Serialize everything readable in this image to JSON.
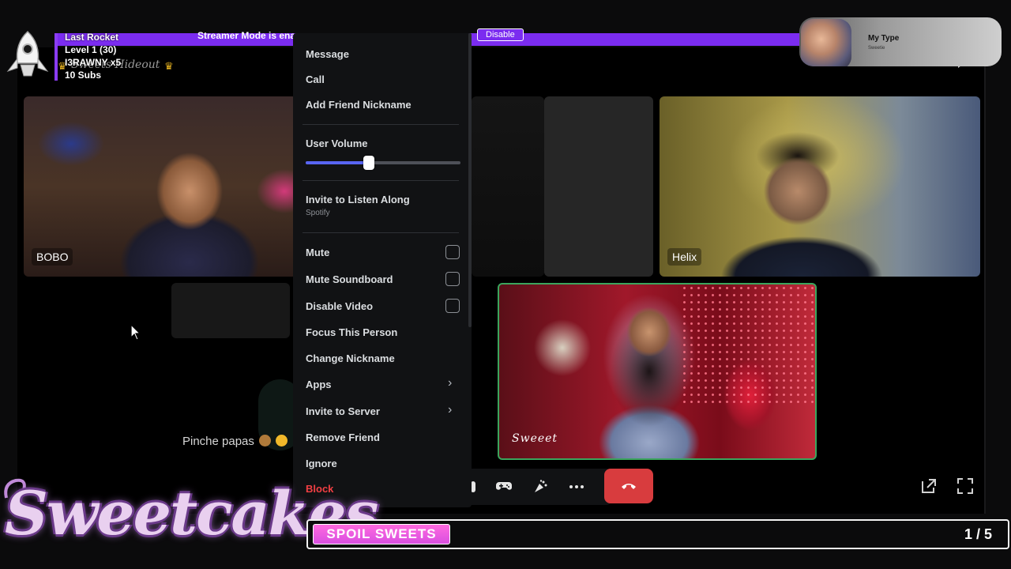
{
  "overlay": {
    "rocket_title": "Last Rocket",
    "level": "Level 1  (30)",
    "supporter": "I3RAWNY x5",
    "subs": "10 Subs"
  },
  "server_title_prefix": "Sweets Hideout",
  "banner": {
    "text": "Streamer Mode is ena",
    "button": "Disable"
  },
  "now_playing": {
    "title": "My Type",
    "artist": "Sweetie"
  },
  "participants": [
    {
      "name": "BOBO"
    },
    {
      "name": "Helix"
    },
    {
      "name": "Sweeet"
    }
  ],
  "chat": {
    "text": "Pinche papas"
  },
  "context_menu": {
    "message": "Message",
    "call": "Call",
    "add_friend_nickname": "Add Friend Nickname",
    "user_volume": "User Volume",
    "volume_level": 0.41,
    "invite_listen": "Invite to Listen Along",
    "invite_listen_sub": "Spotify",
    "mute": "Mute",
    "mute_soundboard": "Mute Soundboard",
    "disable_video": "Disable Video",
    "focus": "Focus This Person",
    "change_nickname": "Change Nickname",
    "apps": "Apps",
    "invite_server": "Invite to Server",
    "remove_friend": "Remove Friend",
    "ignore": "Ignore",
    "block": "Block"
  },
  "brand": "Sweetcakes",
  "spoil_button": "SPOIL SWEETS",
  "page_counter": "1 / 5",
  "colors": {
    "accent": "#5865f2",
    "banner": "#7b2cf0",
    "danger": "#d83c3e",
    "speaking_border": "#3ba55d",
    "block_text": "#f23f43"
  },
  "icons": [
    "rocket-icon",
    "crown-icon",
    "gamepad-icon",
    "soundboard-icon",
    "more-icon",
    "hangup-icon",
    "popout-icon",
    "fullscreen-icon",
    "chevron-right-icon",
    "cursor-icon"
  ]
}
